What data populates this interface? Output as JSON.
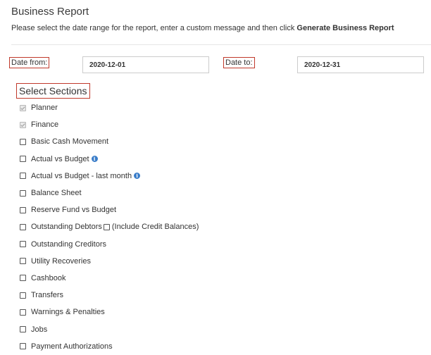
{
  "header": {
    "title": "Business Report",
    "instructions_prefix": "Please select the date range for the report, enter a custom message and then click ",
    "instructions_action": "Generate Business Report"
  },
  "dates": {
    "from_label": "Date from:",
    "from_value": "2020-12-01",
    "to_label": "Date to:",
    "to_value": "2020-12-31"
  },
  "sections": {
    "heading": "Select Sections",
    "items": [
      {
        "label": "Planner",
        "checked": true,
        "disabled": true
      },
      {
        "label": "Finance",
        "checked": true,
        "disabled": true
      },
      {
        "label": "Basic Cash Movement",
        "checked": false
      },
      {
        "label": "Actual vs Budget",
        "checked": false,
        "info_icon": "info-icon"
      },
      {
        "label": "Actual vs Budget - last month",
        "checked": false,
        "info_icon": "info-icon"
      },
      {
        "label": "Balance Sheet",
        "checked": false
      },
      {
        "label": "Reserve Fund vs Budget",
        "checked": false
      },
      {
        "label": "Outstanding Debtors",
        "checked": false,
        "sub_option_label": "(Include Credit Balances)",
        "sub_option_checked": false
      },
      {
        "label": "Outstanding Creditors",
        "checked": false
      },
      {
        "label": "Utility Recoveries",
        "checked": false
      },
      {
        "label": "Cashbook",
        "checked": false
      },
      {
        "label": "Transfers",
        "checked": false
      },
      {
        "label": "Warnings & Penalties",
        "checked": false
      },
      {
        "label": "Jobs",
        "checked": false
      },
      {
        "label": "Payment Authorizations",
        "checked": false
      }
    ]
  },
  "colors": {
    "highlight_border": "#c0392b",
    "info_icon": "#3a7dc9"
  }
}
